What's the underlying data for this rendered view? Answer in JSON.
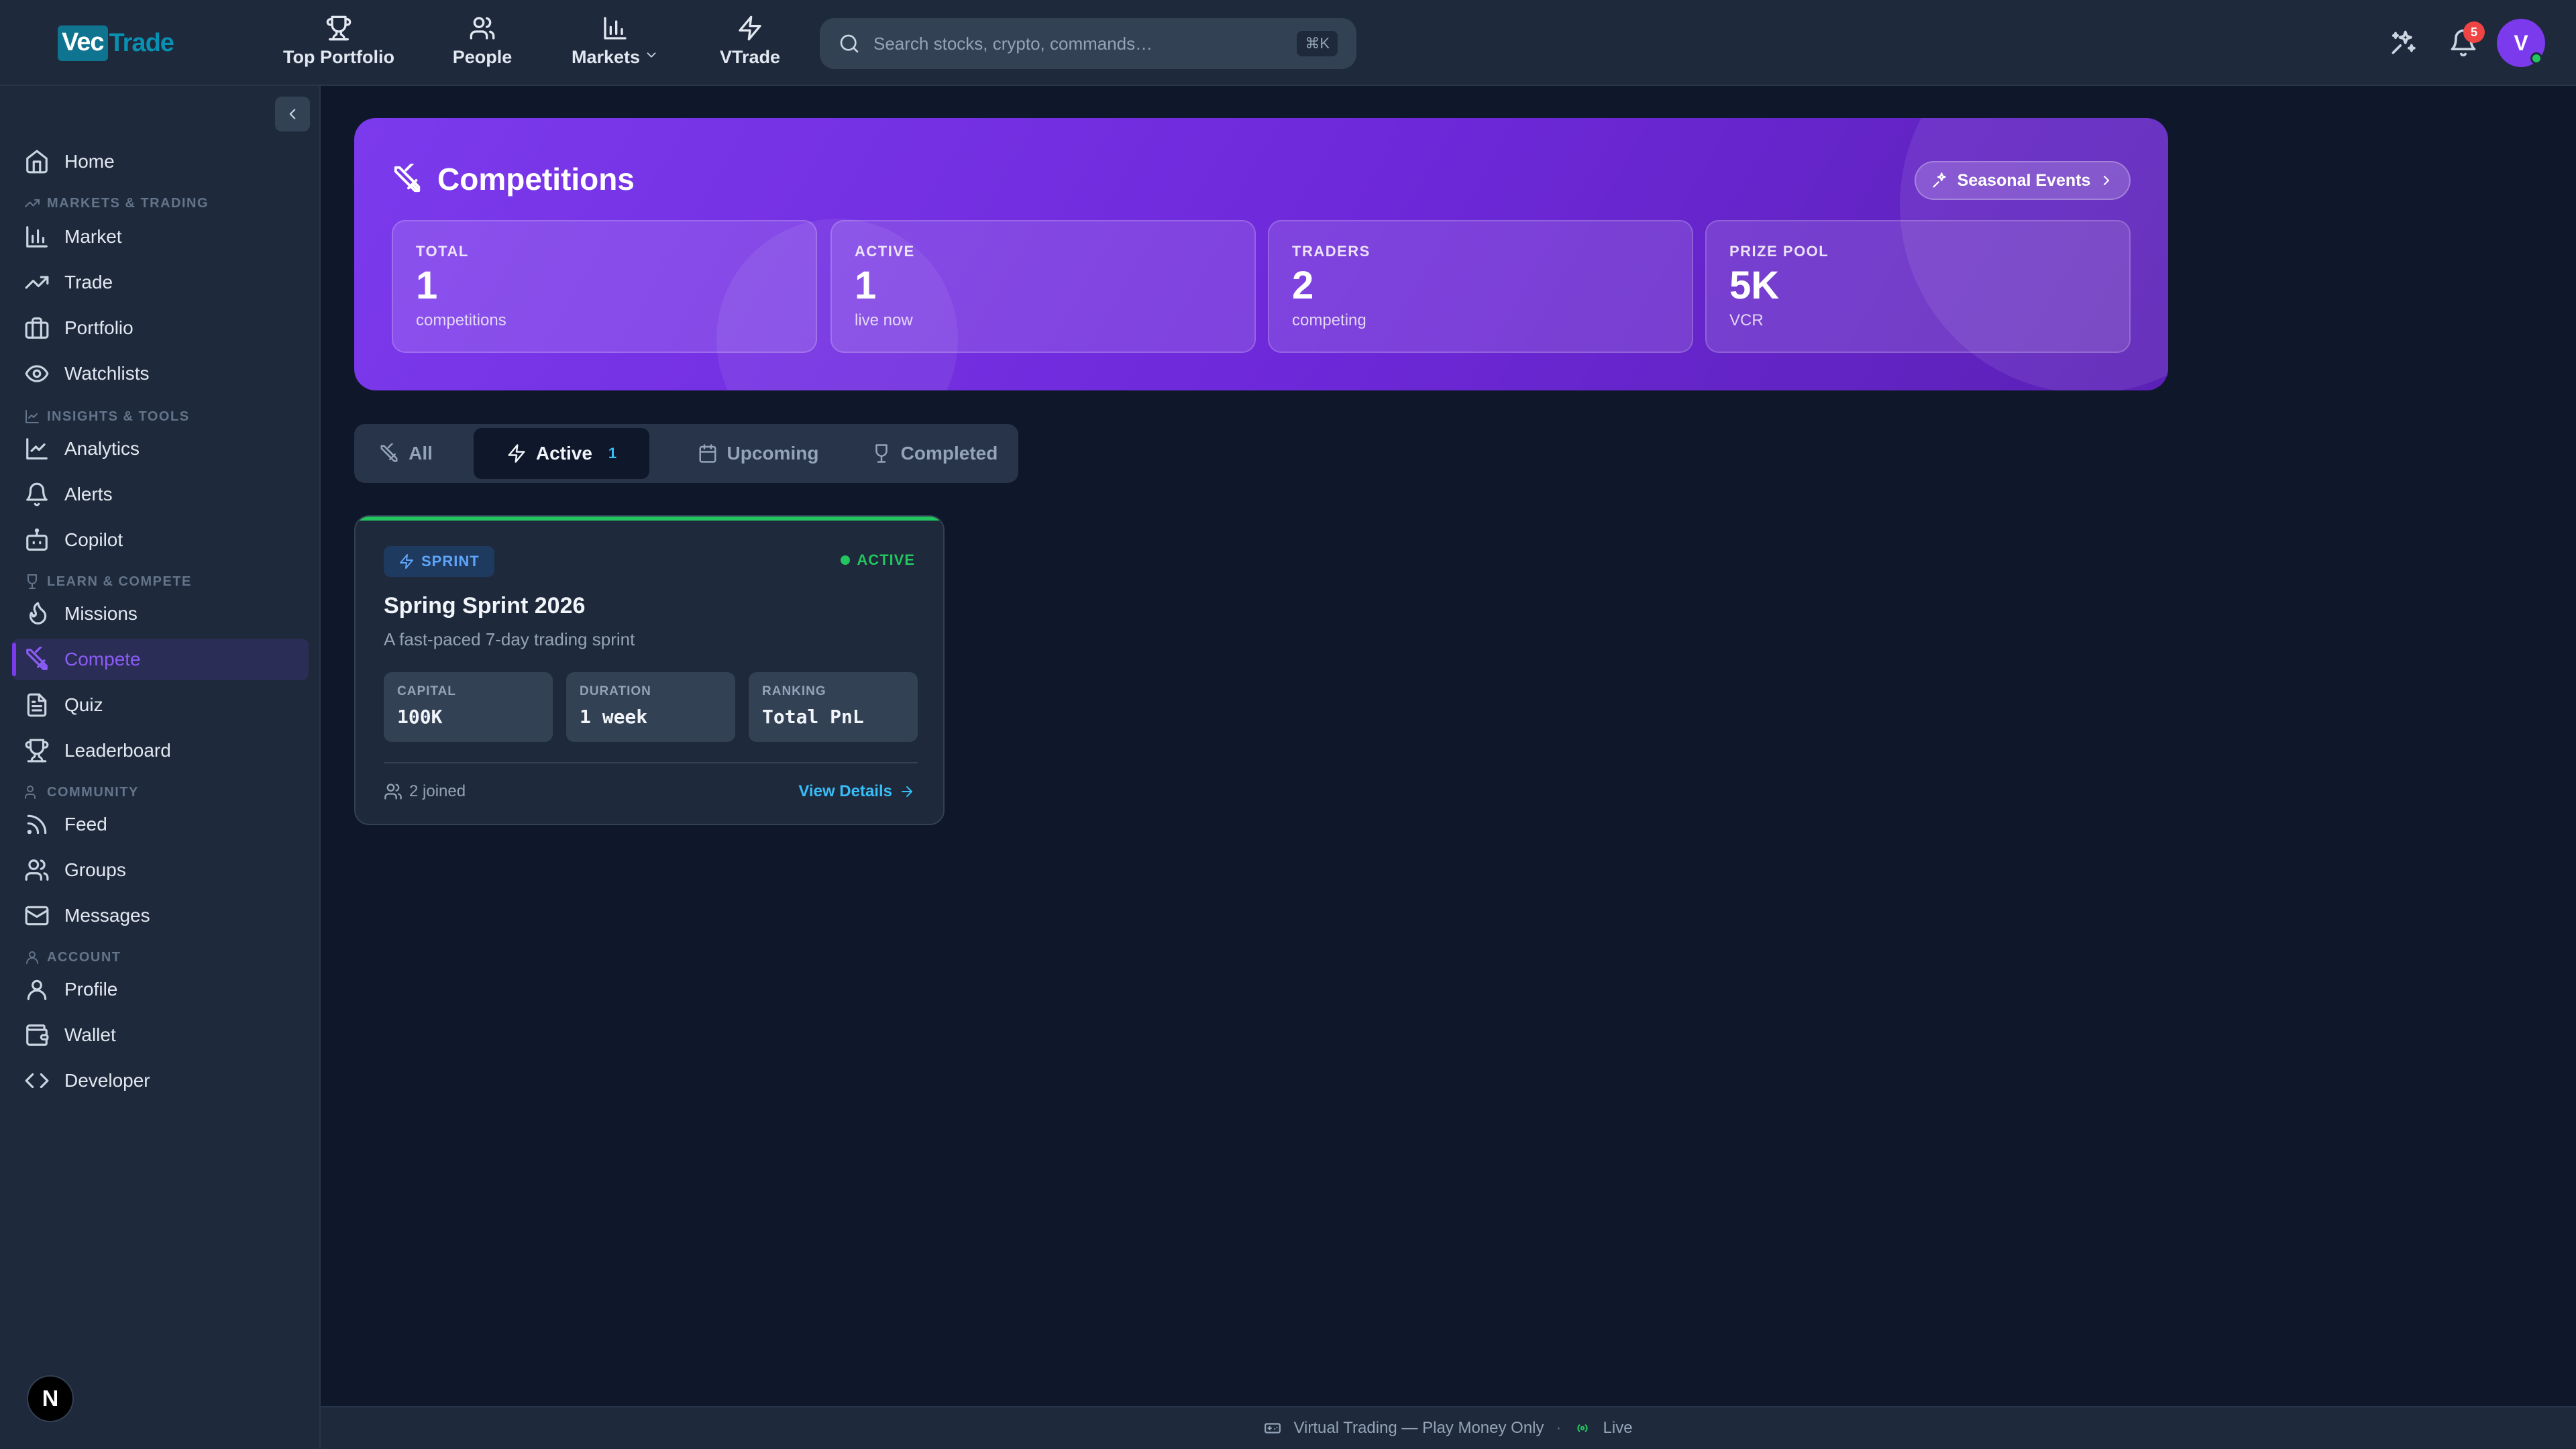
{
  "app": {
    "logo_box": "Vec",
    "logo_rest": "Trade"
  },
  "topnav": {
    "items": [
      {
        "label": "Top Portfolio",
        "icon": "trophy-icon"
      },
      {
        "label": "People",
        "icon": "users-icon"
      },
      {
        "label": "Markets",
        "icon": "bar-chart-icon"
      },
      {
        "label": "VTrade",
        "icon": "zap-icon"
      }
    ],
    "search_placeholder": "Search stocks, crypto, commands…",
    "search_shortcut": "⌘K",
    "notification_count": "5",
    "avatar_initial": "V"
  },
  "sidebar": {
    "home": "Home",
    "sections": {
      "markets": "MARKETS & TRADING",
      "insights": "INSIGHTS & TOOLS",
      "learn": "LEARN & COMPETE",
      "community": "COMMUNITY",
      "account": "ACCOUNT"
    },
    "items": {
      "market": "Market",
      "trade": "Trade",
      "portfolio": "Portfolio",
      "watchlists": "Watchlists",
      "analytics": "Analytics",
      "alerts": "Alerts",
      "copilot": "Copilot",
      "missions": "Missions",
      "compete": "Compete",
      "quiz": "Quiz",
      "leaderboard": "Leaderboard",
      "feed": "Feed",
      "groups": "Groups",
      "messages": "Messages",
      "profile": "Profile",
      "wallet": "Wallet",
      "developer": "Developer"
    },
    "active": "compete",
    "next_badge": "N"
  },
  "hero": {
    "title": "Competitions",
    "seasonal_button": "Seasonal Events",
    "stats": [
      {
        "label": "TOTAL",
        "value": "1",
        "sub": "competitions"
      },
      {
        "label": "ACTIVE",
        "value": "1",
        "sub": "live now"
      },
      {
        "label": "TRADERS",
        "value": "2",
        "sub": "competing"
      },
      {
        "label": "PRIZE POOL",
        "value": "5K",
        "sub": "VCR"
      }
    ]
  },
  "tabs": {
    "all": "All",
    "active": "Active",
    "active_count": "1",
    "upcoming": "Upcoming",
    "completed": "Completed",
    "selected": "active"
  },
  "competition": {
    "type": "SPRINT",
    "status": "ACTIVE",
    "name": "Spring Sprint 2026",
    "description": "A fast-paced 7-day trading sprint",
    "metrics": [
      {
        "label": "CAPITAL",
        "value": "100K"
      },
      {
        "label": "DURATION",
        "value": "1 week"
      },
      {
        "label": "RANKING",
        "value": "Total PnL"
      }
    ],
    "joined": "2 joined",
    "view_details": "View Details"
  },
  "footer": {
    "mode": "Virtual Trading — Play Money Only",
    "separator": "·",
    "live": "Live"
  },
  "colors": {
    "accent": "#7c3aed",
    "active_green": "#22c55e",
    "link_blue": "#38bdf8",
    "background": "#0f172a",
    "panel": "#1e293b"
  }
}
